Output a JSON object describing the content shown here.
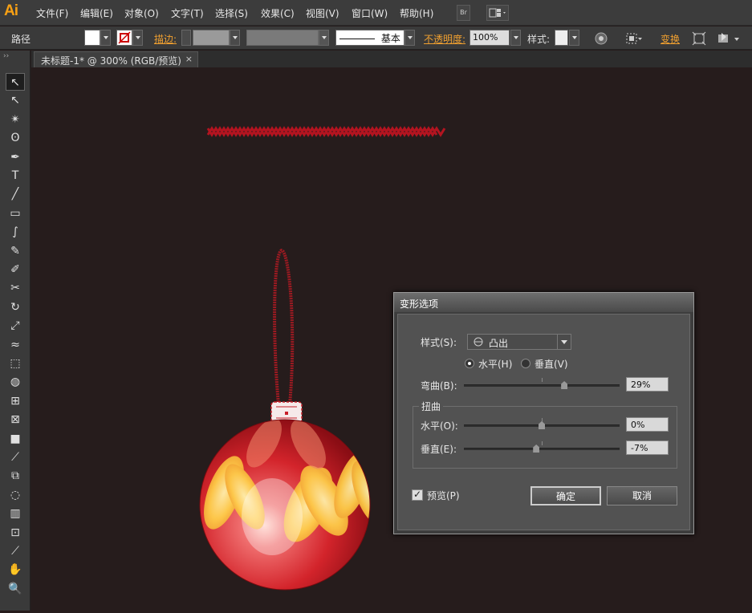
{
  "app": {
    "logo": "Ai"
  },
  "menu": [
    "文件(F)",
    "编辑(E)",
    "对象(O)",
    "文字(T)",
    "选择(S)",
    "效果(C)",
    "视图(V)",
    "窗口(W)",
    "帮助(H)"
  ],
  "menubar_buttons": {
    "bridge": "Br"
  },
  "control_bar": {
    "object_type": "路径",
    "stroke_label": "描边:",
    "brush_name": "基本",
    "opacity_label": "不透明度:",
    "opacity_value": "100%",
    "style_label": "样式:",
    "transform_label": "变换"
  },
  "document_tab": {
    "title": "未标题-1* @ 300% (RGB/预览)",
    "close": "×"
  },
  "tools": [
    "selection-tool",
    "direct-selection-tool",
    "magic-wand-tool",
    "lasso-tool",
    "pen-tool",
    "type-tool",
    "line-tool",
    "rectangle-tool",
    "paintbrush-tool",
    "pencil-tool",
    "blob-brush-tool",
    "scissors-tool",
    "rotate-tool",
    "scale-tool",
    "width-tool",
    "free-transform-tool",
    "shape-builder-tool",
    "perspective-grid-tool",
    "mesh-tool",
    "gradient-tool",
    "eyedropper-tool",
    "blend-tool",
    "symbol-sprayer-tool",
    "column-graph-tool",
    "artboard-tool",
    "slice-tool",
    "hand-tool",
    "zoom-tool"
  ],
  "tool_glyphs": [
    "↖",
    "↖",
    "✴",
    "ʘ",
    "✒",
    "T",
    "╱",
    "▭",
    "∫",
    "✎",
    "✐",
    "✂",
    "↻",
    "⤢",
    "≈",
    "⬚",
    "◍",
    "⊞",
    "⊠",
    "■",
    "⟋",
    "⧉",
    "◌",
    "▥",
    "⊡",
    "⟋",
    "✋",
    "🔍"
  ],
  "canvas": {
    "zigzag_color": "#b31420",
    "ornament_color": "#c9202a"
  },
  "dialog": {
    "title": "变形选项",
    "style_label": "样式(S):",
    "style_value": "凸出",
    "horizontal_label": "水平(H)",
    "vertical_label": "垂直(V)",
    "orientation": "horizontal",
    "bend_label": "弯曲(B):",
    "bend_value": "29%",
    "bend": 29,
    "distortion_label": "扭曲",
    "dist_h_label": "水平(O):",
    "dist_h_value": "0%",
    "dist_h": 0,
    "dist_v_label": "垂直(E):",
    "dist_v_value": "-7%",
    "dist_v": -7,
    "preview_label": "预览(P)",
    "preview_checked": true,
    "ok_label": "确定",
    "cancel_label": "取消"
  }
}
